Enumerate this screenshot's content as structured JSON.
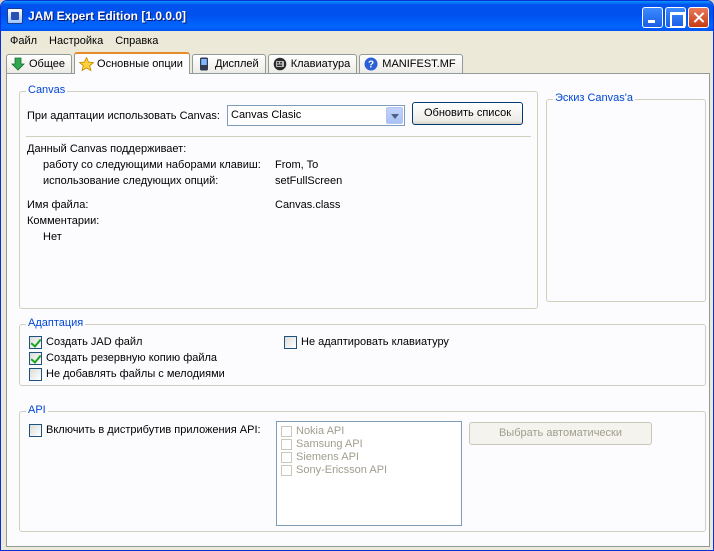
{
  "window": {
    "title": "JAM Expert Edition [1.0.0.0]"
  },
  "menu": [
    {
      "label": "Файл"
    },
    {
      "label": "Настройка"
    },
    {
      "label": "Справка"
    }
  ],
  "tabs": [
    {
      "label": "Общее",
      "icon": "download-arrow-icon"
    },
    {
      "label": "Основные опции",
      "icon": "star-icon"
    },
    {
      "label": "Дисплей",
      "icon": "phone-icon"
    },
    {
      "label": "Клавиатура",
      "icon": "keyboard-icon"
    },
    {
      "label": "MANIFEST.MF",
      "icon": "help-icon"
    }
  ],
  "canvas": {
    "group_title": "Canvas",
    "use_label": "При адаптации использовать Canvas:",
    "selected": "Canvas Clasic",
    "refresh_button": "Обновить список",
    "supports_label": "Данный Canvas поддерживает:",
    "keysets_label": "работу со следующими наборами клавиш:",
    "keysets_value": "From, To",
    "options_label": "использование следующих опций:",
    "options_value": "setFullScreen",
    "filename_label": "Имя файла:",
    "filename_value": "Canvas.class",
    "comments_label": "Комментарии:",
    "comments_value": "Нет"
  },
  "sketch": {
    "group_title": "Эскиз Canvas'a"
  },
  "adaptation": {
    "group_title": "Адаптация",
    "options": [
      {
        "label": "Создать JAD файл",
        "checked": true
      },
      {
        "label": "Создать резервную копию файла",
        "checked": true
      },
      {
        "label": "Не добавлять файлы с мелодиями",
        "checked": false
      },
      {
        "label": "Не адаптировать клавиатуру",
        "checked": false
      }
    ]
  },
  "api": {
    "group_title": "API",
    "include_label": "Включить в дистрибутив приложения API:",
    "include_checked": false,
    "list": [
      {
        "label": "Nokia API"
      },
      {
        "label": "Samsung API"
      },
      {
        "label": "Siemens API"
      },
      {
        "label": "Sony-Ericsson API"
      }
    ],
    "auto_button": "Выбрать автоматически"
  }
}
